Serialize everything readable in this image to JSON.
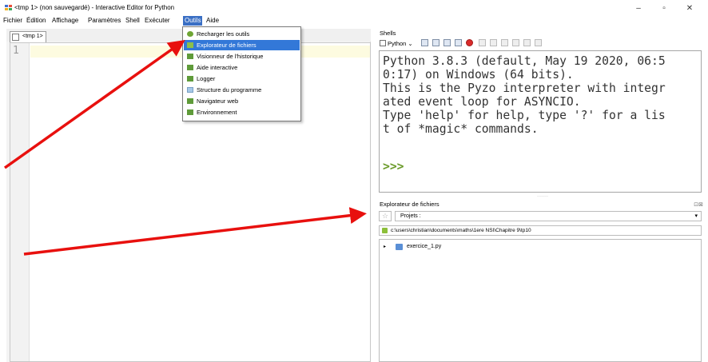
{
  "window": {
    "title": "<tmp 1> (non sauvegardé) - Interactive Editor for Python",
    "minimize": "–",
    "maximize": "▫",
    "close": "✕"
  },
  "menubar": {
    "items": [
      "Fichier",
      "Édition",
      "Affichage",
      "Paramètres",
      "Shell",
      "Exécuter",
      "Outils",
      "Aide"
    ],
    "active": "Outils"
  },
  "editor": {
    "tab_label": "<tmp 1>",
    "line_number": "1"
  },
  "outils_menu": {
    "items": [
      {
        "label": "Recharger les outils",
        "icon": "reload-icon"
      },
      {
        "label": "Explorateur de fichiers",
        "icon": "file-browser-icon",
        "highlighted": true
      },
      {
        "label": "Visionneur de l'historique",
        "icon": "history-icon"
      },
      {
        "label": "Aide interactive",
        "icon": "help-icon"
      },
      {
        "label": "Logger",
        "icon": "logger-icon"
      },
      {
        "label": "Structure du programme",
        "icon": "structure-icon"
      },
      {
        "label": "Navigateur web",
        "icon": "web-icon"
      },
      {
        "label": "Environnement",
        "icon": "environment-icon"
      }
    ]
  },
  "shells": {
    "title": "Shells",
    "interpreter": "Python",
    "output_lines": [
      "Python 3.8.3 (default, May 19 2020, 06:5",
      "0:17) on Windows (64 bits).",
      "This is the Pyzo interpreter with integr",
      "ated event loop for ASYNCIO.",
      "Type 'help' for help, type '?' for a lis",
      "t of *magic* commands."
    ],
    "prompt": ">>>"
  },
  "file_explorer": {
    "title": "Explorateur de fichiers",
    "close_label": "⊡⊠",
    "projects_label": "Projets :",
    "path": "c:\\users\\christian\\documents\\maths\\1ere NSI\\Chapitre 9\\tp10",
    "files": [
      "exercice_1.py"
    ]
  },
  "colors": {
    "menu_active": "#3a6fc4",
    "menu_highlight": "#3378d8",
    "arrow": "#e8100e",
    "prompt": "#6b9b2a"
  }
}
